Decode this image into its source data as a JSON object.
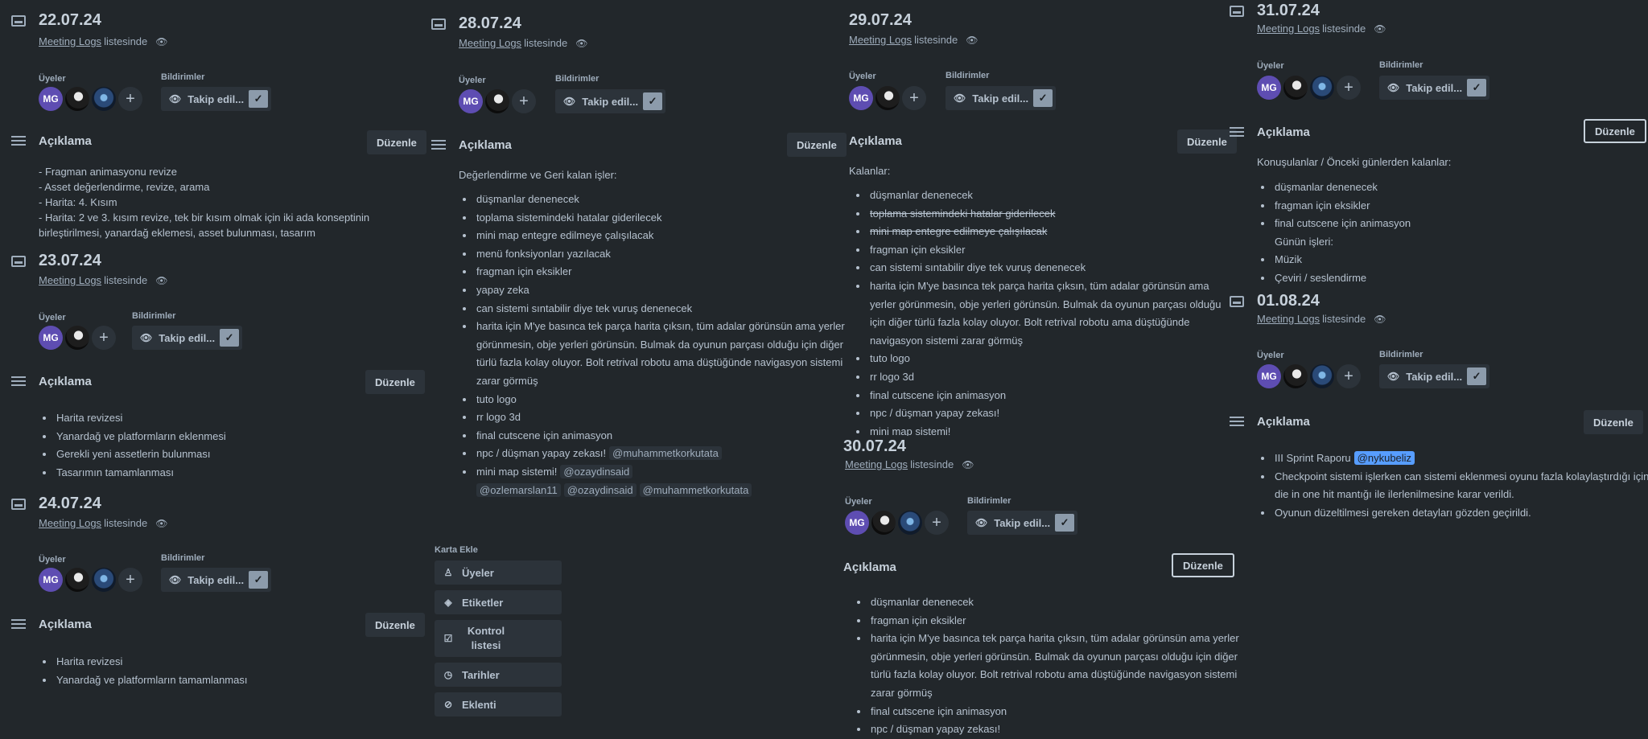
{
  "common": {
    "list_link": "Meeting Logs",
    "list_suffix": "listesinde",
    "members_label": "Üyeler",
    "notifications_label": "Bildirimler",
    "follow_label": "Takip edil...",
    "description_label": "Açıklama",
    "edit_label": "Düzenle",
    "avatar_initials": "MG"
  },
  "cards": {
    "c2207": {
      "date": "22.07.24",
      "lines": [
        "- Fragman animasyonu revize",
        "- Asset değerlendirme, revize, arama",
        "- Harita: 4. Kısım",
        "- Harita: 2 ve 3. kısım revize, tek bir kısım olmak için iki ada konseptinin",
        "birleştirilmesi, yanardağ eklemesi, asset bulunması, tasarım"
      ]
    },
    "c2307": {
      "date": "23.07.24",
      "items": [
        "Harita revizesi",
        "Yanardağ ve platformların eklenmesi",
        "Gerekli yeni assetlerin bulunması",
        "Tasarımın tamamlanması"
      ]
    },
    "c2407": {
      "date": "24.07.24",
      "items": [
        "Harita revizesi",
        "Yanardağ ve platformların tamamlanması"
      ]
    },
    "c2807": {
      "date": "28.07.24",
      "intro": "Değerlendirme ve Geri kalan işler:",
      "items": [
        "düşmanlar denenecek",
        "toplama sistemindeki hatalar giderilecek",
        "mini map entegre edilmeye çalışılacak",
        "menü fonksiyonları yazılacak",
        "fragman için eksikler",
        "yapay zeka",
        "can sistemi sıntabilir diye tek vuruş denenecek",
        "harita için M'ye basınca tek parça harita çıksın, tüm adalar görünsün ama yerler görünmesin, obje yerleri görünsün. Bulmak da oyunun parçası olduğu için diğer türlü fazla kolay oluyor. Bolt retrival robotu ama düştüğünde navigasyon sistemi zarar görmüş",
        "tuto logo",
        "rr logo 3d",
        "final cutscene için animasyon"
      ],
      "npc_text": "npc / düşman yapay zekası!",
      "npc_mention": "@muhammetkorkutata",
      "minimap_text": "mini map sistemi!",
      "minimap_mentions": [
        "@ozaydinsaid",
        "@ozlemarslan11",
        "@ozaydinsaid",
        "@muhammetkorkutata"
      ]
    },
    "c2907": {
      "date": "29.07.24",
      "intro": "Kalanlar:",
      "items": [
        "düşmanlar denenecek",
        "toplama sistemindeki hatalar giderilecek",
        "mini map entegre edilmeye çalışılacak",
        "fragman için eksikler",
        "can sistemi sıntabilir diye tek vuruş denenecek",
        "harita için M'ye basınca tek parça harita çıksın, tüm adalar görünsün ama yerler görünmesin, obje yerleri görünsün. Bulmak da oyunun parçası olduğu için diğer türlü fazla kolay oluyor. Bolt retrival robotu ama düştüğünde navigasyon sistemi zarar görmüş",
        "tuto logo",
        "rr logo 3d",
        "final cutscene için animasyon",
        "npc / düşman yapay zekası!",
        "mini map sistemi!"
      ]
    },
    "c3007": {
      "date": "30.07.24",
      "items": [
        "düşmanlar denenecek",
        "fragman için eksikler",
        "harita için M'ye basınca tek parça harita çıksın, tüm adalar görünsün ama yerler görünmesin, obje yerleri görünsün. Bulmak da oyunun parçası olduğu için diğer türlü fazla kolay oluyor. Bolt retrival robotu ama düştüğünde navigasyon sistemi zarar görmüş",
        "final cutscene için animasyon",
        "npc / düşman yapay zekası!"
      ]
    },
    "c3107": {
      "date": "31.07.24",
      "intro": "Konuşulanlar / Önceki günlerden kalanlar:",
      "items": [
        "düşmanlar denenecek",
        "fragman için eksikler",
        "final cutscene için animasyon"
      ],
      "sub_heading": "Günün işleri:",
      "items2": [
        "Müzik",
        "Çeviri / seslendirme"
      ]
    },
    "c0108": {
      "date": "01.08.24",
      "sprint_text": "III Sprint Raporu",
      "sprint_mention": "@nykubeliz",
      "items": [
        "Checkpoint sistemi işlerken can sistemi eklenmesi oyunu fazla kolaylaştırdığı için die in one hit mantığı ile ilerlenilmesine karar verildi.",
        "Oyunun düzeltilmesi gereken detayları gözden geçirildi."
      ]
    }
  },
  "sidebar": {
    "label": "Karta Ekle",
    "buttons": [
      {
        "label": "Üyeler",
        "icon": "person-icon"
      },
      {
        "label": "Etiketler",
        "icon": "tag-icon"
      },
      {
        "label": "Kontrol listesi",
        "icon": "checklist-icon"
      },
      {
        "label": "Tarihler",
        "icon": "clock-icon"
      },
      {
        "label": "Eklenti",
        "icon": "paperclip-icon"
      }
    ]
  }
}
